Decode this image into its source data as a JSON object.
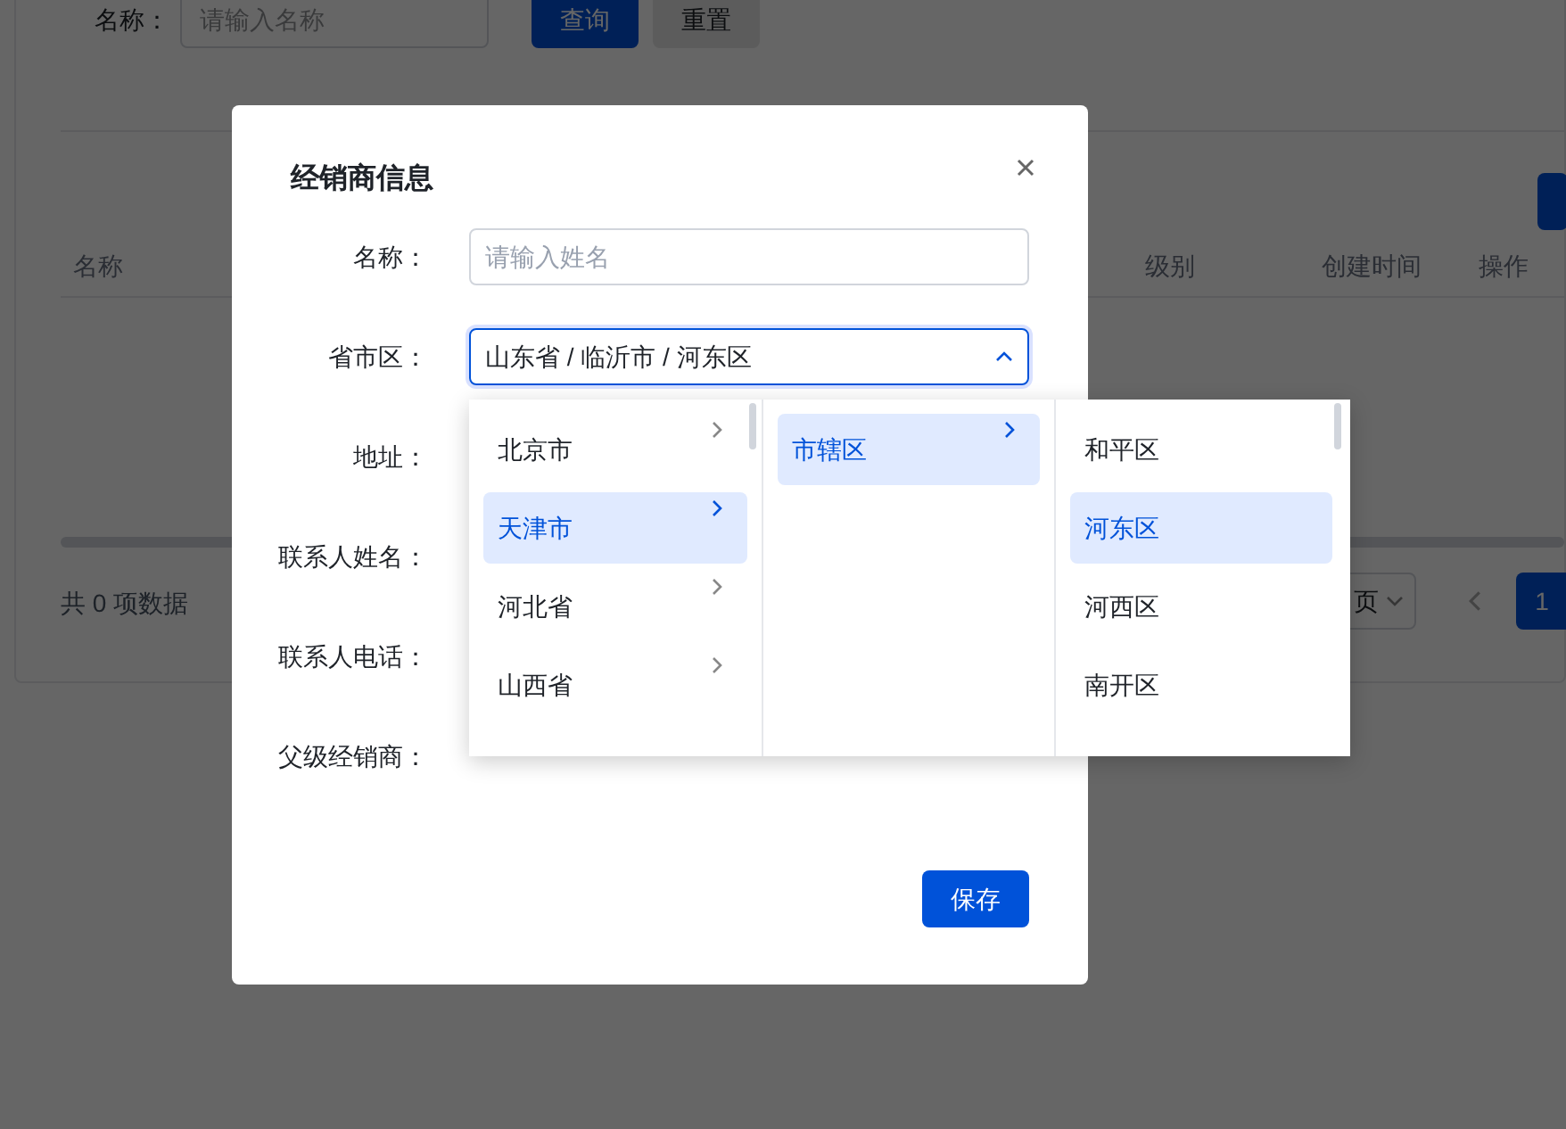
{
  "background_page": {
    "search": {
      "label": "名称：",
      "placeholder": "请输入名称"
    },
    "buttons": [
      {
        "label": "查询",
        "kind": "primary"
      },
      {
        "label": "重置",
        "kind": "default"
      }
    ],
    "table_columns": [
      "名称",
      "级别",
      "创建时间",
      "操作"
    ],
    "total": "共 0 项数据",
    "page_size": "页",
    "pages": [
      {
        "label": "1",
        "selected": true
      }
    ]
  },
  "modal": {
    "title": "经销商信息",
    "fields": [
      {
        "label": "名称：",
        "kind": "input",
        "placeholder": "请输入姓名"
      },
      {
        "label": "省市区：",
        "kind": "cascader",
        "value": "山东省 / 临沂市 / 河东区",
        "expanded": true
      },
      {
        "label": "地址：",
        "kind": "hidden"
      },
      {
        "label": "联系人姓名：",
        "kind": "hidden"
      },
      {
        "label": "联系人电话：",
        "kind": "hidden"
      },
      {
        "label": "父级经销商：",
        "kind": "hidden"
      }
    ],
    "save_button": "保存"
  },
  "cascader_menu": {
    "columns": [
      {
        "items": [
          {
            "label": "北京市",
            "selected": false,
            "has_children": true
          },
          {
            "label": "天津市",
            "selected": true,
            "has_children": true
          },
          {
            "label": "河北省",
            "selected": false,
            "has_children": true
          },
          {
            "label": "山西省",
            "selected": false,
            "has_children": true
          }
        ]
      },
      {
        "items": [
          {
            "label": "市辖区",
            "selected": true,
            "has_children": true
          }
        ]
      },
      {
        "items": [
          {
            "label": "和平区",
            "selected": false,
            "has_children": false
          },
          {
            "label": "河东区",
            "selected": true,
            "has_children": false
          },
          {
            "label": "河西区",
            "selected": false,
            "has_children": false
          },
          {
            "label": "南开区",
            "selected": false,
            "has_children": false
          }
        ]
      }
    ]
  }
}
